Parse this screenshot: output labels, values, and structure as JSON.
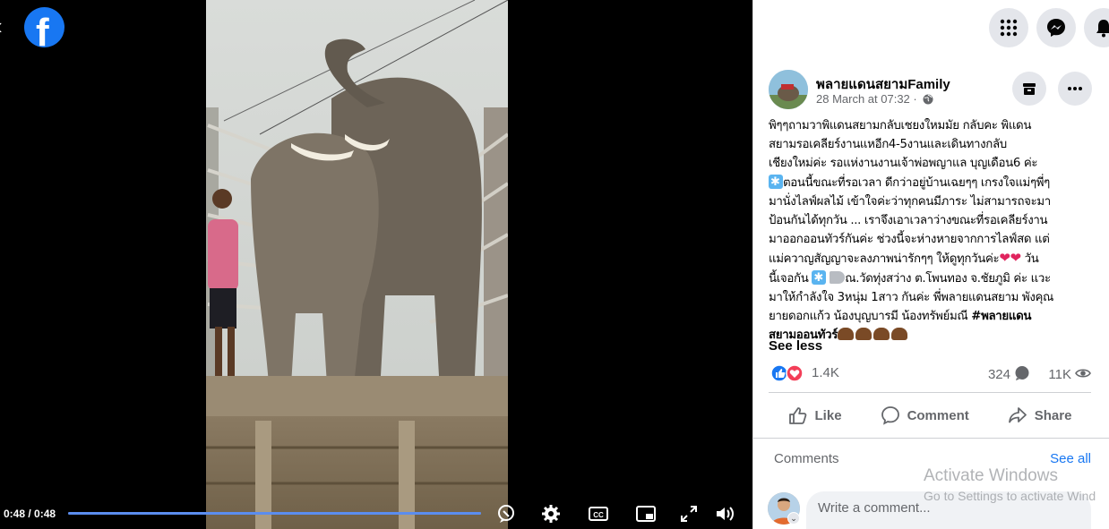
{
  "video": {
    "close_glyph": "‹",
    "logo_letter": "f",
    "time": "0:48 / 0:48",
    "progress": 1.0,
    "controls": [
      "chat-bubble-icon",
      "gear-icon",
      "closed-captions-icon",
      "picture-in-picture-icon",
      "fullscreen-icon",
      "volume-icon"
    ],
    "cc_label": "CC"
  },
  "top_nav": {
    "icons": [
      "apps-grid-icon",
      "messenger-icon",
      "notifications-bell-icon"
    ]
  },
  "post": {
    "page_name": "พลายแดนสยามFamily",
    "time": "28 March at 07:32 ·",
    "text_lines": [
      "พิๆๆถามวาพิแดนสยามกลับเชยงใหมมัย กลับคะ พิแดน",
      "สยามรอเคลียร์งานแหอีก4-5งานและเดินทางกลับ",
      "เชียงใหม่ค่ะ รอแห่งานงานเจ้าพ่อพญาแล บุญเดือน6 ค่ะ",
      "ตอนนี้ขณะที่รอเวลา ดีกว่าอยู่บ้านเฉยๆๆ เกรงใจแม่ๆพี่ๆ",
      "มานั่งไลฟ์ผลไม้ เข้าใจค่ะว่าทุกคนมีภาระ ไม่สามารถจะมา",
      "ป้อนกันได้ทุกวัน ... เราจึงเอาเวลาว่างขณะที่รอเคลียร์งาน",
      "มาออกออนทัวร์กันค่ะ ช่วงนี้จะห่างหายจากการไลฟ์สด แต่",
      "แม่ควาญสัญญาจะลงภาพน่ารักๆๆ ให้ดูทุกวันค่ะ",
      " วัน",
      "นี้เจอกัน",
      "ณ.วัดทุ่งสว่าง ต.โพนทอง จ.ชัยภูมิ ค่ะ แวะ",
      "มาให้กำลังใจ 3หนุ่ม 1สาว กันค่ะ พี่พลายแดนสยาม พังคุณ",
      "ยายดอกแก้ว น้องบุญบารมี น้องทรัพย์มณี",
      "#พลายแดน",
      "สยามออนทัวร์"
    ],
    "see_less": "See less",
    "reaction_count": "1.4K",
    "comment_count": "324",
    "view_count": "11K",
    "actions": {
      "like": "Like",
      "comment": "Comment",
      "share": "Share"
    }
  },
  "comments": {
    "label": "Comments",
    "see_all": "See all",
    "placeholder": "Write a comment..."
  },
  "watermark": {
    "line1": "Activate Windows",
    "line2": "Go to Settings to activate Wind"
  },
  "colors": {
    "brand_blue": "#1877f2",
    "love_red": "#f33e58",
    "progress_blue": "#5b8def"
  }
}
